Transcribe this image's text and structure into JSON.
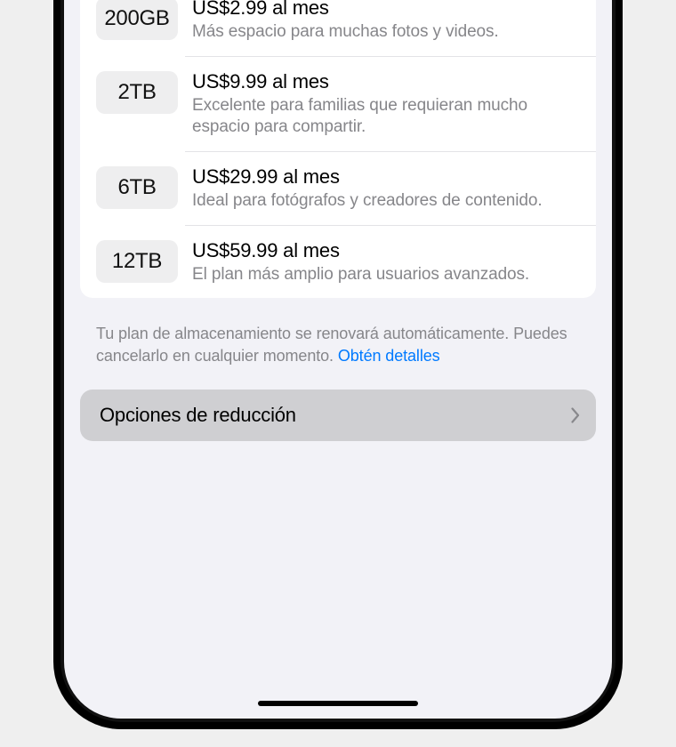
{
  "plans": [
    {
      "size": "200GB",
      "price": "US$2.99 al mes",
      "desc": "Más espacio para muchas fotos y videos."
    },
    {
      "size": "2TB",
      "price": "US$9.99 al mes",
      "desc": "Excelente para familias que requieran mucho espacio para compartir."
    },
    {
      "size": "6TB",
      "price": "US$29.99 al mes",
      "desc": "Ideal para fotógrafos y creadores de contenido."
    },
    {
      "size": "12TB",
      "price": "US$59.99 al mes",
      "desc": "El plan más amplio para usuarios avanzados."
    }
  ],
  "footer": {
    "text": "Tu plan de almacenamiento se renovará automáticamente. Puedes cancelarlo en cualquier momento. ",
    "link": "Obtén detalles"
  },
  "downgrade": {
    "label": "Opciones de reducción"
  }
}
